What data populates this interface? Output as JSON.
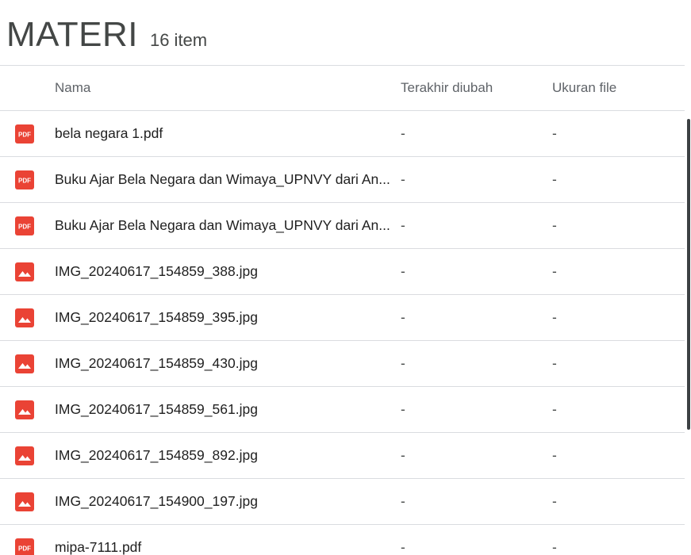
{
  "folder": {
    "title": "MATERI",
    "count": "16 item"
  },
  "columns": {
    "name": "Nama",
    "modified": "Terakhir diubah",
    "size": "Ukuran file"
  },
  "colors": {
    "pdf_icon": "#ea4335",
    "image_icon": "#ea4335"
  },
  "files": [
    {
      "type": "pdf",
      "icon": "pdf-icon",
      "name": "bela negara 1.pdf",
      "modified": "-",
      "size": "-"
    },
    {
      "type": "pdf",
      "icon": "pdf-icon",
      "name": "Buku Ajar Bela Negara dan Wimaya_UPNVY dari An...",
      "modified": "-",
      "size": "-"
    },
    {
      "type": "pdf",
      "icon": "pdf-icon",
      "name": "Buku Ajar Bela Negara dan Wimaya_UPNVY dari An...",
      "modified": "-",
      "size": "-"
    },
    {
      "type": "image",
      "icon": "image-icon",
      "name": "IMG_20240617_154859_388.jpg",
      "modified": "-",
      "size": "-"
    },
    {
      "type": "image",
      "icon": "image-icon",
      "name": "IMG_20240617_154859_395.jpg",
      "modified": "-",
      "size": "-"
    },
    {
      "type": "image",
      "icon": "image-icon",
      "name": "IMG_20240617_154859_430.jpg",
      "modified": "-",
      "size": "-"
    },
    {
      "type": "image",
      "icon": "image-icon",
      "name": "IMG_20240617_154859_561.jpg",
      "modified": "-",
      "size": "-"
    },
    {
      "type": "image",
      "icon": "image-icon",
      "name": "IMG_20240617_154859_892.jpg",
      "modified": "-",
      "size": "-"
    },
    {
      "type": "image",
      "icon": "image-icon",
      "name": "IMG_20240617_154900_197.jpg",
      "modified": "-",
      "size": "-"
    },
    {
      "type": "pdf",
      "icon": "pdf-icon",
      "name": "mipa-7111.pdf",
      "modified": "-",
      "size": "-"
    }
  ]
}
